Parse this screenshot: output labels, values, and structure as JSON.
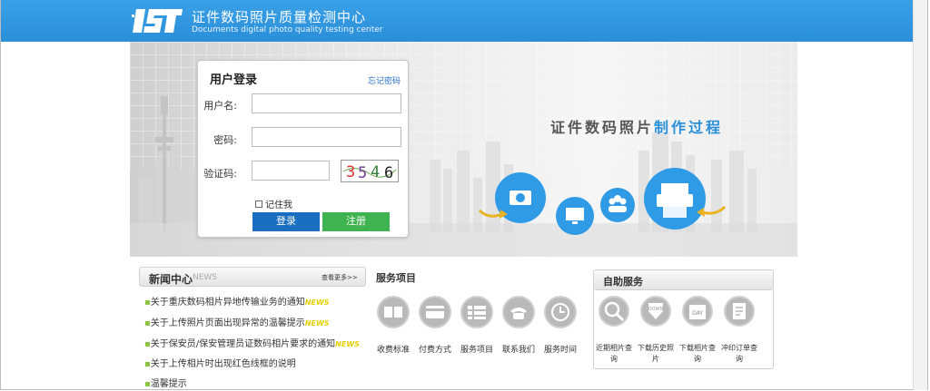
{
  "header": {
    "title": "证件数码照片质量检测中心",
    "subtitle": "Documents digital photo quality testing center",
    "logo": "IST logo"
  },
  "banner": {
    "title_part1": "证件数码照片",
    "title_part2": "制作过程"
  },
  "login": {
    "title": "用户登录",
    "forgot": "忘记密码",
    "username_label": "用户名:",
    "password_label": "密码:",
    "captcha_label": "验证码:",
    "username_value": "",
    "password_value": "",
    "captcha_value": "",
    "captcha_text": "3546",
    "remember": "记住我",
    "login_button": "登录",
    "register_button": "注册"
  },
  "news": {
    "title": "新闻中心",
    "title_en": "NEWS",
    "more": "查看更多>>",
    "tag": "NEWS",
    "items": [
      {
        "text": "关于重庆数码相片异地传输业务的通知",
        "new": true
      },
      {
        "text": "关于上传照片页面出现异常的温馨提示",
        "new": true
      },
      {
        "text": "关于保安员/保安管理员证数码相片要求的通知",
        "new": true
      },
      {
        "text": "关于上传相片时出现红色线框的说明",
        "new": false
      },
      {
        "text": "温馨提示",
        "new": false
      }
    ]
  },
  "services": {
    "title": "服务项目",
    "items": [
      "收费标准",
      "付费方式",
      "服务项目",
      "联系我们",
      "服务时间"
    ]
  },
  "self_service": {
    "title": "自助服务",
    "items": [
      "近期相片查询",
      "下载历史照片",
      "下载相片查询",
      "冲印订单查询"
    ],
    "icon_texts": [
      "",
      "DOWN",
      "DAY",
      ""
    ]
  },
  "colors": {
    "header_blue": "#2a8fd9",
    "login_btn": "#1a6ec2",
    "register_btn": "#3fb34f",
    "news_tag": "#e5d000"
  }
}
